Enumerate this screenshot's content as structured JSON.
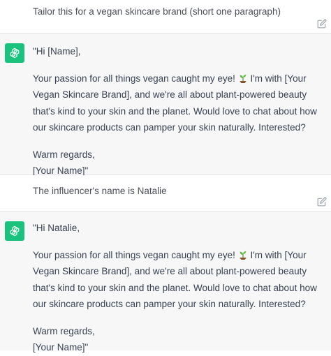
{
  "conversation": {
    "prompt_1": "Tailor this for a vegan skincare brand (short one paragraph)",
    "reply_1": {
      "greeting": "\"Hi [Name],",
      "body_before_emoji": "Your passion for all things vegan caught my eye!",
      "body_after_emoji": "I'm with [Your Vegan Skincare Brand], and we're all about plant-powered beauty that's kind to your skin and the planet. Would love to chat about how our skincare products can pamper your skin naturally. Interested?",
      "closing": "Warm regards,",
      "signature": "[Your Name]\""
    },
    "prompt_2": "The influencer's name is Natalie",
    "reply_2": {
      "greeting": "\"Hi Natalie,",
      "body_before_emoji": "Your passion for all things vegan caught my eye!",
      "body_after_emoji": "I'm with [Your Vegan Skincare Brand], and we're all about plant-powered beauty that's kind to your skin and the planet. Would love to chat about how our skincare products can pamper your skin naturally. Interested?",
      "closing": "Warm regards,",
      "signature": "[Your Name]\""
    }
  },
  "icons": {
    "edit": "edit-icon",
    "assistant_avatar": "openai-logo-icon",
    "emoji": "seedling-emoji-icon"
  },
  "colors": {
    "avatar_bg": "#19c37d",
    "assistant_bg": "#f7f7f8"
  }
}
